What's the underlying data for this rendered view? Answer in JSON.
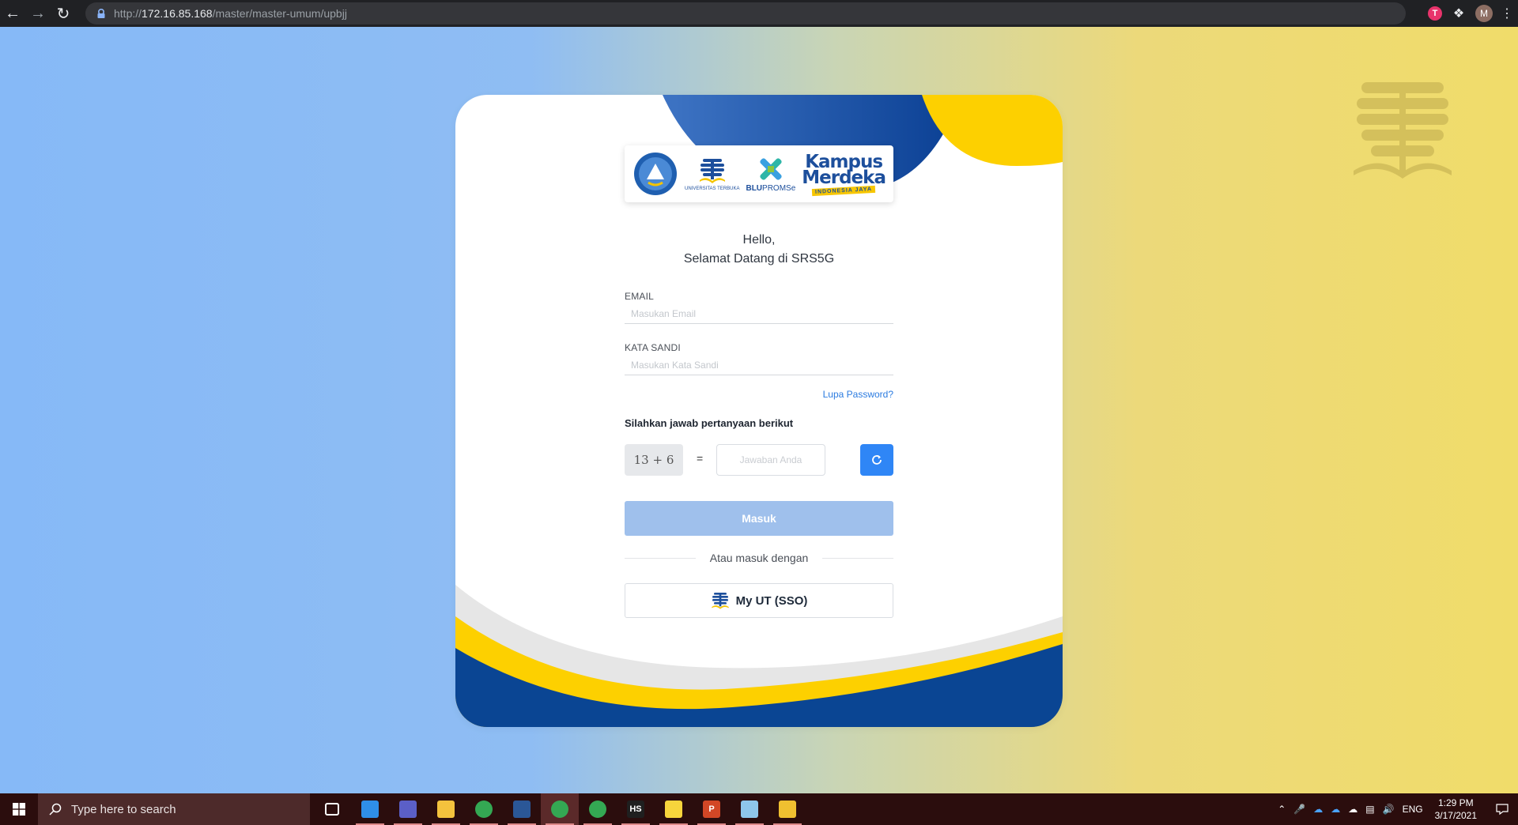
{
  "browser": {
    "url_prefix": "http://",
    "url_host": "172.16.85.168",
    "url_path": "/master/master-umum/upbjj",
    "ext_badge": "T",
    "profile_initial": "M"
  },
  "logos": {
    "ut_caption": "UNIVERSITAS TERBUKA",
    "blu_bold": "BLU",
    "blu_rest": "PROMSe",
    "km_line1": "Kampus",
    "km_line2": "Merdeka",
    "km_sub": "INDONESIA JAYA"
  },
  "login": {
    "greeting_line1": "Hello,",
    "greeting_line2": "Selamat Datang di SRS5G",
    "email_label": "EMAIL",
    "email_placeholder": "Masukan Email",
    "email_value": "",
    "password_label": "KATA SANDI",
    "password_placeholder": "Masukan Kata Sandi",
    "password_value": "",
    "forgot_label": "Lupa Password?",
    "question_label": "Silahkan jawab pertanyaan berikut",
    "captcha_expression": "13 + 6",
    "equals_sign": "=",
    "answer_placeholder": "Jawaban Anda",
    "submit_label": "Masuk",
    "divider_label": "Atau masuk dengan",
    "sso_label": "My UT (SSO)"
  },
  "taskbar": {
    "search_placeholder": "Type here to search",
    "apps": [
      {
        "name": "task-view",
        "color": "#ffffff"
      },
      {
        "name": "vscode",
        "color": "#2f8ee8"
      },
      {
        "name": "teams",
        "color": "#5b5fc7"
      },
      {
        "name": "file-explorer",
        "color": "#f4c23d"
      },
      {
        "name": "chrome",
        "color": "#34a853"
      },
      {
        "name": "word",
        "color": "#2b5797"
      },
      {
        "name": "chrome-profile-m",
        "color": "#34a853"
      },
      {
        "name": "chrome-2",
        "color": "#34a853"
      },
      {
        "name": "hs-app",
        "color": "#1f1f1f",
        "text": "HS"
      },
      {
        "name": "sticky-notes",
        "color": "#f7d53c"
      },
      {
        "name": "powerpoint",
        "color": "#d24726",
        "text": "P"
      },
      {
        "name": "notepad-app",
        "color": "#8ec6ea"
      },
      {
        "name": "git-app",
        "color": "#f0c030"
      }
    ],
    "lang": "ENG",
    "time": "1:29 PM",
    "date": "3/17/2021"
  },
  "colors": {
    "primary_blue": "#2f86f6",
    "brand_navy": "#0a4593",
    "brand_yellow": "#fdd000",
    "submit_disabled": "#9fc0ec"
  }
}
